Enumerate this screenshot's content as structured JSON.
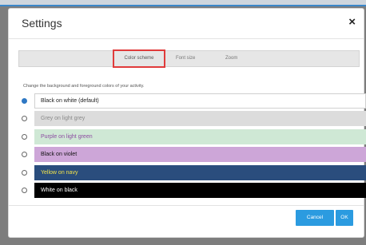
{
  "dialog": {
    "title": "Settings",
    "close_glyph": "×"
  },
  "tabs": [
    {
      "label": "Color scheme",
      "active": true
    },
    {
      "label": "Font size"
    },
    {
      "label": "Zoom"
    }
  ],
  "description": "Change the background and foreground colors of your activity.",
  "options": [
    {
      "label": "Black on white (default)",
      "selected": true,
      "bg": "#ffffff",
      "fg": "#222222"
    },
    {
      "label": "Grey on light grey",
      "selected": false,
      "bg": "#dcdcdc",
      "fg": "#8a8a8a"
    },
    {
      "label": "Purple on light green",
      "selected": false,
      "bg": "#cfe8d5",
      "fg": "#8c4ba1"
    },
    {
      "label": "Black on violet",
      "selected": false,
      "bg": "#cda6d8",
      "fg": "#111111"
    },
    {
      "label": "Yellow on navy",
      "selected": false,
      "bg": "#2a4d7d",
      "fg": "#f2e34a"
    },
    {
      "label": "White on black",
      "selected": false,
      "bg": "#000000",
      "fg": "#ffffff"
    }
  ],
  "buttons": {
    "cancel": "Cancel",
    "ok": "OK"
  },
  "colors": {
    "accent": "#2b9be0",
    "highlight": "#e03b3b"
  }
}
